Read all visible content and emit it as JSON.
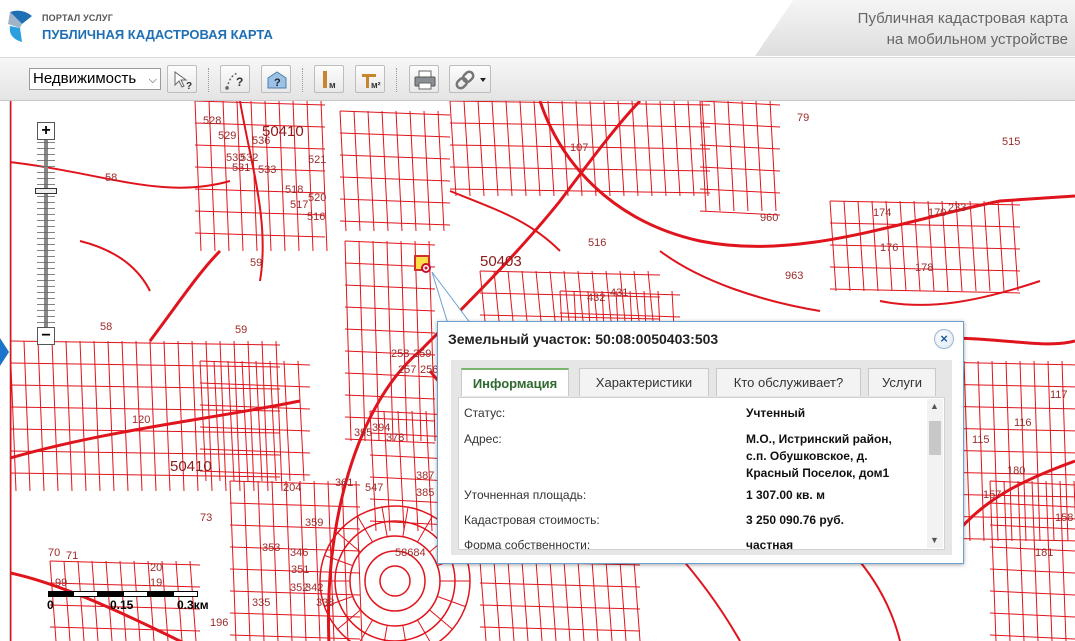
{
  "header": {
    "portal_small": "ПОРТАЛ УСЛУГ",
    "portal_big": "ПУБЛИЧНАЯ КАДАСТРОВАЯ КАРТА",
    "mobile_line1": "Публичная кадастровая карта",
    "mobile_line2": "на мобильном устройстве"
  },
  "toolbar": {
    "layer_select_value": "Недвижимость",
    "icons": [
      "select-identify-icon",
      "measure-distance-icon",
      "identify-building-icon",
      "measure-length-icon",
      "measure-area-icon",
      "print-icon",
      "link-icon"
    ]
  },
  "map": {
    "labels": [
      "528",
      "529",
      "530",
      "531",
      "536",
      "532",
      "533",
      "521",
      "518",
      "517",
      "516",
      "520",
      "50410",
      "58",
      "59",
      "50403",
      "516",
      "432",
      "431",
      "960",
      "963",
      "515",
      "174",
      "176",
      "178",
      "170",
      "233",
      "107",
      "79",
      "59",
      "58",
      "258",
      "259",
      "257",
      "256",
      "120",
      "50410",
      "394",
      "395",
      "378",
      "387",
      "385",
      "547",
      "361",
      "204",
      "359",
      "353",
      "346",
      "351",
      "352",
      "342",
      "335",
      "338",
      "58684",
      "73",
      "70",
      "71",
      "99",
      "20",
      "19",
      "196",
      "115",
      "116",
      "117",
      "180",
      "157",
      "158",
      "181"
    ],
    "accent_color": "#e0141c"
  },
  "scale": {
    "labels": [
      "0",
      "0.15",
      "0.3км"
    ]
  },
  "popup": {
    "title": "Земельный участок: 50:08:0050403:503",
    "close": "×",
    "tabs": [
      "Информация",
      "Характеристики",
      "Кто обслуживает?",
      "Услуги"
    ],
    "rows": [
      {
        "label": "Статус:",
        "value": "Учтенный"
      },
      {
        "label": "Адрес:",
        "value_lines": [
          "М.О., Истринский район,",
          "с.п. Обушковское, д.",
          "Красный Поселок, дом1"
        ]
      },
      {
        "label": "Уточненная площадь:",
        "value": "1 307.00 кв. м"
      },
      {
        "label": "Кадастровая стоимость:",
        "value": "3 250 090.76 руб."
      },
      {
        "label": "Форма собственности:",
        "value": "частная"
      }
    ]
  }
}
